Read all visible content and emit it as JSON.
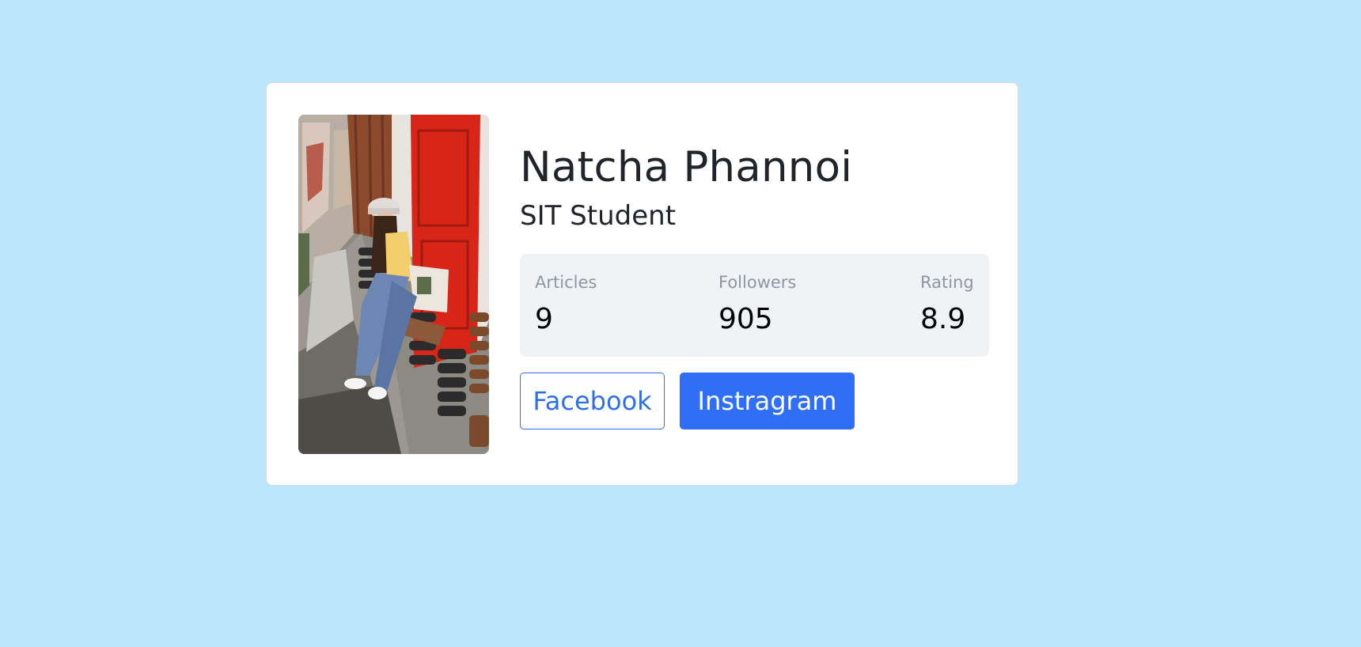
{
  "profile": {
    "name": "Natcha Phannoi",
    "title": "SIT Student"
  },
  "stats": [
    {
      "label": "Articles",
      "value": "9"
    },
    {
      "label": "Followers",
      "value": "905"
    },
    {
      "label": "Rating",
      "value": "8.9"
    }
  ],
  "buttons": {
    "facebook": "Facebook",
    "instagram": "Instragram"
  },
  "colors": {
    "background": "#bbe6fb",
    "card": "#ffffff",
    "stats_panel": "#f0f3f6",
    "primary": "#2f6ff5",
    "muted_label": "#8c96a4",
    "text": "#212529"
  },
  "icons": {
    "photo": "profile-photo"
  }
}
